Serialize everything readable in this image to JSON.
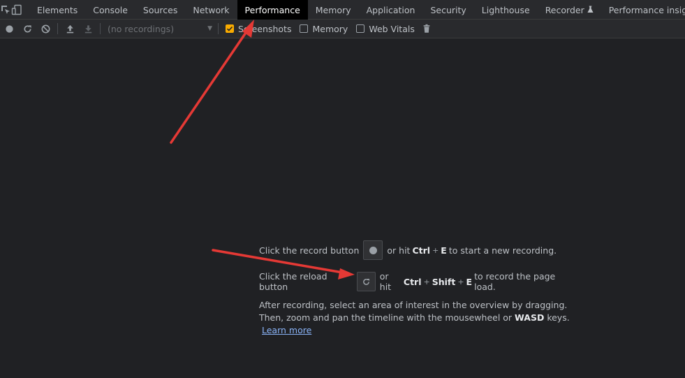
{
  "tabs": [
    {
      "label": "Elements",
      "name": "tab-elements",
      "active": false,
      "experimental": false
    },
    {
      "label": "Console",
      "name": "tab-console",
      "active": false,
      "experimental": false
    },
    {
      "label": "Sources",
      "name": "tab-sources",
      "active": false,
      "experimental": false
    },
    {
      "label": "Network",
      "name": "tab-network",
      "active": false,
      "experimental": false
    },
    {
      "label": "Performance",
      "name": "tab-performance",
      "active": true,
      "experimental": false
    },
    {
      "label": "Memory",
      "name": "tab-memory",
      "active": false,
      "experimental": false
    },
    {
      "label": "Application",
      "name": "tab-application",
      "active": false,
      "experimental": false
    },
    {
      "label": "Security",
      "name": "tab-security",
      "active": false,
      "experimental": false
    },
    {
      "label": "Lighthouse",
      "name": "tab-lighthouse",
      "active": false,
      "experimental": false
    },
    {
      "label": "Recorder",
      "name": "tab-recorder",
      "active": false,
      "experimental": true
    },
    {
      "label": "Performance insights",
      "name": "tab-performance-insights",
      "active": false,
      "experimental": true
    }
  ],
  "toolbar": {
    "recordings_placeholder": "(no recordings)",
    "screenshots_label": "Screenshots",
    "screenshots_checked": true,
    "memory_label": "Memory",
    "memory_checked": false,
    "web_vitals_label": "Web Vitals",
    "web_vitals_checked": false
  },
  "landing": {
    "record_prefix": "Click the record button",
    "record_or": "or hit",
    "record_key1": "Ctrl",
    "record_key2": "E",
    "record_suffix": "to start a new recording.",
    "reload_prefix": "Click the reload button",
    "reload_or": "or hit",
    "reload_key1": "Ctrl",
    "reload_key2": "Shift",
    "reload_key3": "E",
    "reload_suffix": "to record the page load.",
    "para_part1": "After recording, select an area of interest in the overview by dragging. Then, zoom and pan the timeline with the mousewheel or",
    "para_keys": "WASD",
    "para_part2": "keys.",
    "learn_more": "Learn more"
  },
  "colors": {
    "background": "#202124",
    "toolbar": "#292a2d",
    "active_tab": "#000000",
    "checkbox_accent": "#f9ab00",
    "link": "#8ab4f8",
    "annotation_arrow": "#e53935"
  }
}
